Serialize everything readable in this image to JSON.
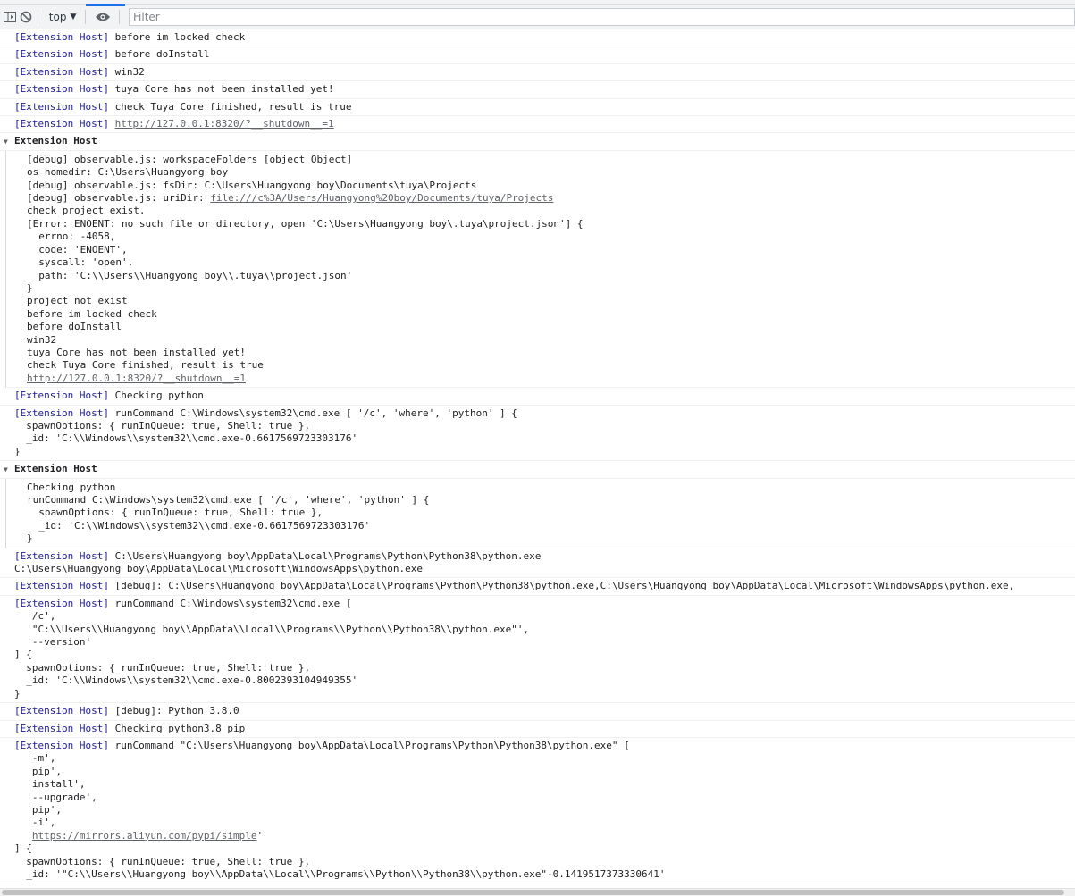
{
  "toolbar": {
    "context": "top",
    "filter_placeholder": "Filter"
  },
  "prefix": "[Extension Host]",
  "logs": {
    "m1": "before im locked check",
    "m2": "before doInstall",
    "m3": "win32",
    "m4": "tuya Core has not been installed yet!",
    "m5": "check Tuya Core finished, result is true",
    "m6_url": "http://127.0.0.1:8320/?__shutdown__=1",
    "group1_title": "Extension Host",
    "g1_l1": "[debug] observable.js: workspaceFolders [object Object]",
    "g1_l2": "os homedir: C:\\Users\\Huangyong boy",
    "g1_l3": "[debug] observable.js: fsDir: C:\\Users\\Huangyong boy\\Documents\\tuya\\Projects",
    "g1_l4": "[debug] observable.js: uriDir: ",
    "g1_l4_url": "file:///c%3A/Users/Huangyong%20boy/Documents/tuya/Projects",
    "g1_l5": "check project exist.\n[Error: ENOENT: no such file or directory, open 'C:\\Users\\Huangyong boy\\.tuya\\project.json'] {\n  errno: -4058,\n  code: 'ENOENT',\n  syscall: 'open',\n  path: 'C:\\\\Users\\\\Huangyong boy\\\\.tuya\\\\project.json'\n}\nproject not exist\nbefore im locked check\nbefore doInstall\nwin32\ntuya Core has not been installed yet!\ncheck Tuya Core finished, result is true",
    "g1_url": "http://127.0.0.1:8320/?__shutdown__=1",
    "m7": "Checking python",
    "m8": "runCommand C:\\Windows\\system32\\cmd.exe [ '/c', 'where', 'python' ] {\n  spawnOptions: { runInQueue: true, Shell: true },\n  _id: 'C:\\\\Windows\\\\system32\\\\cmd.exe-0.6617569723303176'\n}",
    "group2_title": "Extension Host",
    "g2_text": "Checking python\nrunCommand C:\\Windows\\system32\\cmd.exe [ '/c', 'where', 'python' ] {\n  spawnOptions: { runInQueue: true, Shell: true },\n  _id: 'C:\\\\Windows\\\\system32\\\\cmd.exe-0.6617569723303176'\n}",
    "m9": "C:\\Users\\Huangyong boy\\AppData\\Local\\Programs\\Python\\Python38\\python.exe\nC:\\Users\\Huangyong boy\\AppData\\Local\\Microsoft\\WindowsApps\\python.exe",
    "m10": "[debug]: C:\\Users\\Huangyong boy\\AppData\\Local\\Programs\\Python\\Python38\\python.exe,C:\\Users\\Huangyong boy\\AppData\\Local\\Microsoft\\WindowsApps\\python.exe,",
    "m11": "runCommand C:\\Windows\\system32\\cmd.exe [\n  '/c',\n  '\"C:\\\\Users\\\\Huangyong boy\\\\AppData\\\\Local\\\\Programs\\\\Python\\\\Python38\\\\python.exe\"',\n  '--version'\n] {\n  spawnOptions: { runInQueue: true, Shell: true },\n  _id: 'C:\\\\Windows\\\\system32\\\\cmd.exe-0.8002393104949355'\n}",
    "m12": "[debug]: Python 3.8.0",
    "m13": "Checking python3.8 pip",
    "m14a": "runCommand \"C:\\Users\\Huangyong boy\\AppData\\Local\\Programs\\Python\\Python38\\python.exe\" [\n  '-m',\n  'pip',\n  'install',\n  '--upgrade',\n  'pip',\n  '-i',\n  '",
    "m14_url": "https://mirrors.aliyun.com/pypi/simple",
    "m14b": "'\n] {\n  spawnOptions: { runInQueue: true, Shell: true },\n  _id: '\"C:\\\\Users\\\\Huangyong boy\\\\AppData\\\\Local\\\\Programs\\\\Python\\\\Python38\\\\python.exe\"-0.1419517373330641'"
  }
}
